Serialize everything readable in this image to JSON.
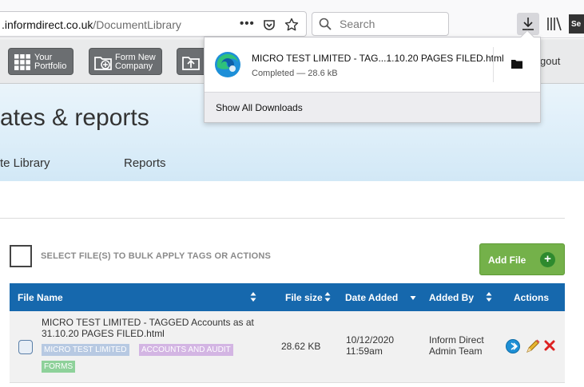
{
  "browser": {
    "url_domain": ".informdirect.co.uk",
    "url_path": "/DocumentLibrary",
    "search_placeholder": "Search",
    "sidebar_label": "Se"
  },
  "app_toolbar": {
    "buttons": [
      {
        "line1": "Your",
        "line2": "Portfolio"
      },
      {
        "line1": "Form New",
        "line2": "Company"
      }
    ],
    "logout_fragment": "gout"
  },
  "page": {
    "title": "ates & reports",
    "tabs": [
      "te Library",
      "Reports"
    ]
  },
  "downloads": {
    "file_name": "MICRO TEST LIMITED - TAG...1.10.20 PAGES FILED.html",
    "status": "Completed — 28.6 kB",
    "show_all": "Show All Downloads"
  },
  "bulk": {
    "label": "SELECT FILE(S) TO BULK APPLY TAGS OR ACTIONS",
    "add_file": "Add File"
  },
  "table": {
    "columns": [
      "File Name",
      "File size",
      "Date Added",
      "Added By",
      "Actions"
    ],
    "rows": [
      {
        "name": "MICRO TEST LIMITED - TAGGED Accounts as at 31.10.20 PAGES FILED.html",
        "tags": [
          "MICRO TEST LIMITED",
          "ACCOUNTS AND AUDIT",
          "FORMS"
        ],
        "size": "28.62 KB",
        "date_line1": "10/12/2020",
        "date_line2": "11:59am",
        "by_line1": "Inform Direct",
        "by_line2": "Admin Team"
      }
    ]
  },
  "colors": {
    "table_header": "#1668ad",
    "add_file": "#74b14a",
    "tag_company": "#b7c9e2",
    "tag_accounts": "#d3b5e3",
    "tag_forms": "#8ed19a"
  }
}
